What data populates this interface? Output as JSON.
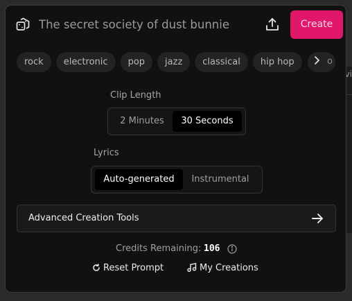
{
  "background": {
    "peek_text": "vi"
  },
  "header": {
    "prompt_title": "The secret society of dust bunnie",
    "create_label": "Create"
  },
  "tags": [
    "rock",
    "electronic",
    "pop",
    "jazz",
    "classical",
    "hip hop"
  ],
  "tags_next_peek": "o",
  "clip_length": {
    "label": "Clip Length",
    "options": [
      "2 Minutes",
      "30 Seconds"
    ],
    "selected": "30 Seconds"
  },
  "lyrics": {
    "label": "Lyrics",
    "options": [
      "Auto-generated",
      "Instrumental"
    ],
    "selected": "Auto-generated"
  },
  "advanced": {
    "label": "Advanced Creation Tools"
  },
  "credits": {
    "label": "Credits Remaining:",
    "value": "106"
  },
  "footer": {
    "reset_label": "Reset Prompt",
    "creations_label": "My Creations"
  },
  "colors": {
    "accent": "#e0176b",
    "panel": "#111111",
    "background": "#2a2a2a"
  }
}
